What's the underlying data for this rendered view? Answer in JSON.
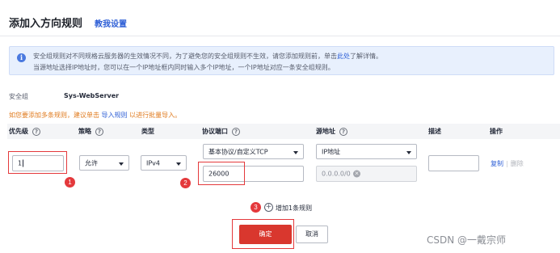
{
  "header": {
    "title": "添加入方向规则",
    "tutorial_link": "教我设置"
  },
  "info": {
    "icon": "info-icon",
    "line1_prefix": "安全组规则对不同规格云服务器的生效情况不同，为了避免您的安全组规则不生效，请您添加规则前，单击",
    "line1_link": "此处",
    "line1_suffix": "了解详情。",
    "line2": "当源地址选择IP地址时，您可以在一个IP地址框内同时输入多个IP地址，一个IP地址对应一条安全组规则。"
  },
  "security_group": {
    "label": "安全组",
    "value": "Sys-WebServer"
  },
  "batch_hint": {
    "prefix": "如您要添加多条规则，建议单击",
    "link": "导入规则",
    "suffix": "以进行批量导入。"
  },
  "table": {
    "headers": {
      "priority": "优先级",
      "policy": "策略",
      "type": "类型",
      "protocol_port": "协议端口",
      "source": "源地址",
      "description": "描述",
      "actions": "操作"
    },
    "help_icon": "?",
    "row": {
      "priority": "1",
      "policy": "允许",
      "type": "IPv4",
      "protocol": "基本协议/自定义TCP",
      "port": "26000",
      "source_type": "IP地址",
      "source_ip": "0.0.0.0/0",
      "description": "",
      "copy": "复制",
      "separator": "|",
      "delete": "删除"
    }
  },
  "add_rule": {
    "icon": "+",
    "label": "增加1条规则"
  },
  "buttons": {
    "ok": "确定",
    "cancel": "取消"
  },
  "annotations": {
    "badge1": "1",
    "badge2": "2",
    "badge3": "3"
  },
  "watermark": "CSDN @一戴宗师",
  "colors": {
    "accent": "#2e5fd6",
    "danger": "#d9372e",
    "annotation": "#e4393c",
    "warning": "#e07b1f"
  }
}
